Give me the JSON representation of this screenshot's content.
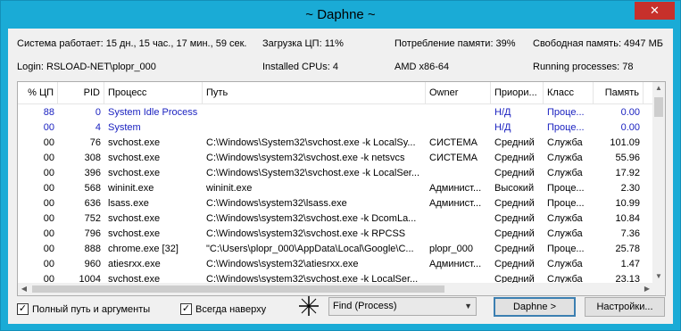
{
  "window": {
    "title": "~ Daphne ~",
    "close_label": "✕"
  },
  "info": {
    "uptime": "Система работает: 15 дн., 15 час., 17 мин., 59 сек.",
    "cpu_load": "Загрузка ЦП:  11%",
    "mem_usage": "Потребление памяти:  39%",
    "free_mem": "Свободная память: 4947 МБ",
    "login": "Login: RSLOAD-NET\\plopr_000",
    "cpus": "Installed CPUs:  4",
    "arch": "AMD x86-64",
    "running": "Running processes:   78"
  },
  "table": {
    "columns": [
      "% ЦП",
      "PID",
      "Процесс",
      "Путь",
      "Owner",
      "Приори...",
      "Класс",
      "Память"
    ],
    "rows": [
      [
        "88",
        "0",
        "System Idle Process",
        "",
        "",
        "Н/Д",
        "Проце...",
        "0.00"
      ],
      [
        "00",
        "4",
        "System",
        "",
        "",
        "Н/Д",
        "Проце...",
        "0.00"
      ],
      [
        "00",
        "76",
        "svchost.exe",
        "C:\\Windows\\System32\\svchost.exe -k LocalSy...",
        "СИСТЕМА",
        "Средний",
        "Служба",
        "101.09"
      ],
      [
        "00",
        "308",
        "svchost.exe",
        "C:\\Windows\\system32\\svchost.exe -k netsvcs",
        "СИСТЕМА",
        "Средний",
        "Служба",
        "55.96"
      ],
      [
        "00",
        "396",
        "svchost.exe",
        "C:\\Windows\\System32\\svchost.exe -k LocalSer...",
        "",
        "Средний",
        "Служба",
        "17.92"
      ],
      [
        "00",
        "568",
        "wininit.exe",
        "wininit.exe",
        "Админист...",
        "Высокий",
        "Проце...",
        "2.30"
      ],
      [
        "00",
        "636",
        "lsass.exe",
        "C:\\Windows\\system32\\lsass.exe",
        "Админист...",
        "Средний",
        "Проце...",
        "10.99"
      ],
      [
        "00",
        "752",
        "svchost.exe",
        "C:\\Windows\\system32\\svchost.exe -k DcomLa...",
        "",
        "Средний",
        "Служба",
        "10.84"
      ],
      [
        "00",
        "796",
        "svchost.exe",
        "C:\\Windows\\system32\\svchost.exe -k RPCSS",
        "",
        "Средний",
        "Служба",
        "7.36"
      ],
      [
        "00",
        "888",
        "chrome.exe [32]",
        "\"C:\\Users\\plopr_000\\AppData\\Local\\Google\\C...",
        "plopr_000",
        "Средний",
        "Проце...",
        "25.78"
      ],
      [
        "00",
        "960",
        "atiesrxx.exe",
        "C:\\Windows\\system32\\atiesrxx.exe",
        "Админист...",
        "Средний",
        "Служба",
        "1.47"
      ],
      [
        "00",
        "1004",
        "svchost.exe",
        "C:\\Windows\\system32\\svchost.exe -k LocalSer...",
        "",
        "Средний",
        "Служба",
        "23.13"
      ]
    ]
  },
  "controls": {
    "full_path_label": "Полный путь и аргументы",
    "full_path_checked": "✓",
    "always_on_top_label": "Всегда наверху",
    "always_on_top_checked": "✓",
    "find_value": "Find (Process)",
    "daphne_button": "Daphne >",
    "settings_button": "Настройки..."
  },
  "colors": {
    "titlebar": "#1aabd6",
    "system_row_text": "#1b22c0",
    "close_button": "#c7302b"
  }
}
